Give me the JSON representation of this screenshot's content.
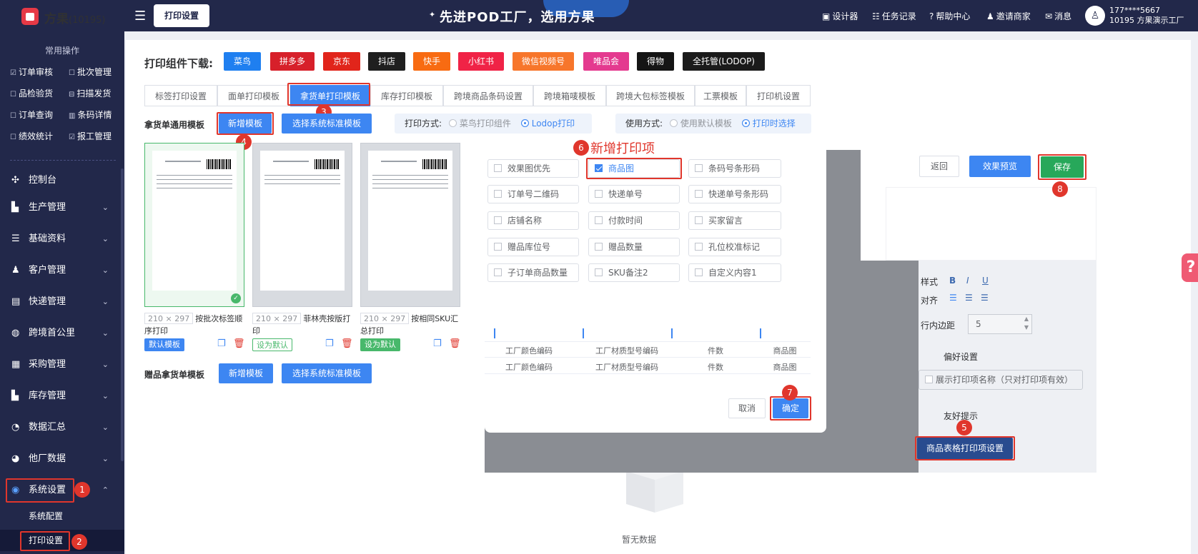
{
  "header": {
    "brand": "方果",
    "brand_count": "(10195)",
    "current_tab": "打印设置",
    "slogan": "先进POD工厂，选用方果",
    "nav": [
      {
        "icon": "image-icon",
        "label": "设计器"
      },
      {
        "icon": "task-icon",
        "label": "任务记录"
      },
      {
        "icon": "help-icon",
        "label": "帮助中心"
      },
      {
        "icon": "user-icon",
        "label": "邀请商家"
      },
      {
        "icon": "message-icon",
        "label": "消息"
      }
    ],
    "user_phone": "177****5667",
    "user_factory": "10195 方果演示工厂"
  },
  "sidebar": {
    "section_title": "常用操作",
    "quick": [
      "订单审核",
      "批次管理",
      "品检验货",
      "扫描发货",
      "订单查询",
      "条码详情",
      "绩效统计",
      "报工管理"
    ],
    "items": [
      {
        "icon": "dashboard-icon",
        "label": "控制台",
        "chevron": ""
      },
      {
        "icon": "factory-icon",
        "label": "生产管理",
        "chevron": "⌄"
      },
      {
        "icon": "database-icon",
        "label": "基础资料",
        "chevron": "⌄"
      },
      {
        "icon": "customer-icon",
        "label": "客户管理",
        "chevron": "⌄"
      },
      {
        "icon": "truck-icon",
        "label": "快递管理",
        "chevron": "⌄"
      },
      {
        "icon": "globe-icon",
        "label": "跨境首公里",
        "chevron": "⌄"
      },
      {
        "icon": "cart-icon",
        "label": "采购管理",
        "chevron": "⌄"
      },
      {
        "icon": "warehouse-icon",
        "label": "库存管理",
        "chevron": "⌄"
      },
      {
        "icon": "pie-icon",
        "label": "数据汇总",
        "chevron": "⌄"
      },
      {
        "icon": "chart-icon",
        "label": "他厂数据",
        "chevron": "⌄"
      },
      {
        "icon": "settings-icon",
        "label": "系统设置",
        "chevron": "⌃"
      }
    ],
    "sub_items": [
      "系统配置",
      "打印设置"
    ]
  },
  "main": {
    "download_title": "打印组件下载:",
    "chips": [
      {
        "label": "菜鸟",
        "color": "#1f7ff0"
      },
      {
        "label": "拼多多",
        "color": "#d7202a"
      },
      {
        "label": "京东",
        "color": "#e1251b"
      },
      {
        "label": "抖店",
        "color": "#1f1f1f"
      },
      {
        "label": "快手",
        "color": "#f86b12"
      },
      {
        "label": "小红书",
        "color": "#f02346"
      },
      {
        "label": "微信视频号",
        "color": "#f7762b"
      },
      {
        "label": "唯品会",
        "color": "#e43a8f"
      },
      {
        "label": "得物",
        "color": "#151515"
      },
      {
        "label": "全托管(LODOP)",
        "color": "#1b1b1b"
      }
    ],
    "tabs": [
      "标签打印设置",
      "面单打印模板",
      "拿货单打印模板",
      "库存打印模板",
      "跨境商品条码设置",
      "跨境箱唛模板",
      "跨境大包标签模板",
      "工票模板",
      "打印机设置"
    ],
    "section1_label": "拿货单通用模板",
    "new_template": "新增模板",
    "choose_std": "选择系统标准模板",
    "print_mode_label": "打印方式:",
    "print_mode_opt1": "菜鸟打印组件",
    "print_mode_opt2": "Lodop打印",
    "use_mode_label": "使用方式:",
    "use_mode_opt1": "使用默认模板",
    "use_mode_opt2": "打印时选择",
    "templates": [
      {
        "size": "210 × 297",
        "name": "按批次标签顺序打印",
        "tag": "默认模板"
      },
      {
        "size": "210 × 297",
        "name": "菲林壳按版打印",
        "tag": "设为默认"
      },
      {
        "size": "210 × 297",
        "name": "按相同SKU汇总打印",
        "tag": "设为默认"
      }
    ],
    "section2_label": "赠品拿货单模板",
    "empty_text": "暂无数据"
  },
  "dialog": {
    "annotation": "新增打印项",
    "checkboxes": [
      {
        "label": "效果图优先",
        "checked": false
      },
      {
        "label": "商品图",
        "checked": true
      },
      {
        "label": "条码号条形码",
        "checked": false
      },
      {
        "label": "订单号二维码",
        "checked": false
      },
      {
        "label": "快递单号",
        "checked": false
      },
      {
        "label": "快递单号条形码",
        "checked": false
      },
      {
        "label": "店铺名称",
        "checked": false
      },
      {
        "label": "付款时间",
        "checked": false
      },
      {
        "label": "买家留言",
        "checked": false
      },
      {
        "label": "赠品库位号",
        "checked": false
      },
      {
        "label": "赠品数量",
        "checked": false
      },
      {
        "label": "孔位校准标记",
        "checked": false
      },
      {
        "label": "子订单商品数量",
        "checked": false
      },
      {
        "label": "SKU备注2",
        "checked": false
      },
      {
        "label": "自定义内容1",
        "checked": false
      }
    ],
    "table_rows": [
      [
        "工厂颜色编码",
        "工厂材质型号编码",
        "件数",
        "商品图"
      ],
      [
        "工厂颜色编码",
        "工厂材质型号编码",
        "件数",
        "商品图"
      ]
    ],
    "cancel": "取消",
    "confirm": "确定"
  },
  "editor": {
    "back": "返回",
    "preview": "效果预览",
    "save": "保存",
    "style_label": "样式",
    "style_b": "B",
    "style_i": "I",
    "style_u": "U",
    "align_label": "对齐",
    "padding_label": "行内边距",
    "padding_value": "5",
    "pref_title": "偏好设置",
    "pref_option": "展示打印项名称（只对打印项有效）",
    "tip_title": "友好提示",
    "goods_table_btn": "商品表格打印项设置"
  },
  "markers": [
    "1",
    "2",
    "3",
    "4",
    "5",
    "6",
    "7",
    "8"
  ]
}
